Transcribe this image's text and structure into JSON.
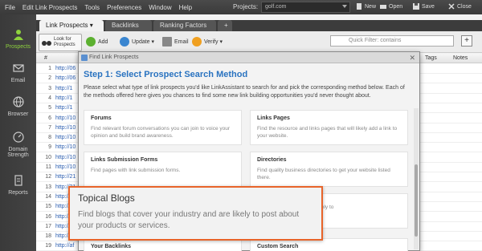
{
  "menu": [
    "File",
    "Edit Link Prospects",
    "Tools",
    "Preferences",
    "Window",
    "Help"
  ],
  "projects": {
    "label": "Projects:",
    "value": "golf.com"
  },
  "top_buttons": {
    "new": "New",
    "open": "Open",
    "save": "Save",
    "close": "Close"
  },
  "sidebar": {
    "items": [
      {
        "label": "Prospects",
        "icon": "person-icon"
      },
      {
        "label": "Email",
        "icon": "envelope-icon"
      },
      {
        "label": "Browser",
        "icon": "globe-icon"
      },
      {
        "label": "Domain Strength",
        "label_lines": [
          "Domain",
          "Strength"
        ],
        "icon": "gauge-icon"
      },
      {
        "label": "Reports",
        "icon": "document-icon"
      }
    ]
  },
  "tabs": [
    "Link Prospects",
    "Backlinks",
    "Ranking Factors",
    "+"
  ],
  "toolbar": {
    "look_for_prospects": [
      "Look for",
      "Prospects"
    ],
    "add": "Add",
    "update": "Update",
    "email": "Email",
    "verify": "Verify",
    "filter_placeholder": "Quick Filter: contains"
  },
  "table": {
    "headers": {
      "num": "#",
      "tags": "Tags",
      "notes": "Notes"
    },
    "rows": [
      {
        "num": "1",
        "url": "http://06"
      },
      {
        "num": "2",
        "url": "http://06"
      },
      {
        "num": "3",
        "url": "http://1"
      },
      {
        "num": "4",
        "url": "http://1"
      },
      {
        "num": "5",
        "url": "http://1"
      },
      {
        "num": "6",
        "url": "http://10"
      },
      {
        "num": "7",
        "url": "http://10"
      },
      {
        "num": "8",
        "url": "http://10"
      },
      {
        "num": "9",
        "url": "http://10"
      },
      {
        "num": "10",
        "url": "http://10"
      },
      {
        "num": "11",
        "url": "http://10"
      },
      {
        "num": "12",
        "url": "http://21"
      },
      {
        "num": "13",
        "url": "http://21"
      },
      {
        "num": "14",
        "url": "http://3"
      },
      {
        "num": "15",
        "url": "http://3"
      },
      {
        "num": "16",
        "url": "http://3"
      },
      {
        "num": "17",
        "url": "http://3"
      },
      {
        "num": "18",
        "url": "http://4"
      },
      {
        "num": "19",
        "url": "http://af"
      }
    ]
  },
  "dialog": {
    "title": "Find Link Prospects",
    "step": "Step 1: Select Prospect Search Method",
    "description": "Please select what type of link prospects you'd like LinkAssistant to search for and pick the corresponding method below. Each of the methods offered here gives you chances to find some new link building opportunities you'd never thought about.",
    "cards": [
      {
        "title": "Forums",
        "desc": "Find relevant forum conversations you can join to voice your opinion and build brand awareness."
      },
      {
        "title": "Links Pages",
        "desc": "Find the resource and links pages that will likely add a link to your website."
      },
      {
        "title": "Links Submission Forms",
        "desc": "Find pages with link submission forms."
      },
      {
        "title": "Directories",
        "desc": "Find quality business directories to get your website listed there."
      },
      {
        "title": "",
        "desc": "your competitors and are likely to"
      },
      {
        "title": "Your Backlinks",
        "desc": ""
      },
      {
        "title": "Custom Search",
        "desc": ""
      }
    ]
  },
  "callout": {
    "title": "Topical Blogs",
    "body": "Find blogs that cover your industry and are likely to post about your products or services."
  },
  "colors": {
    "accent_green": "#8ed23e",
    "link_blue": "#2a5db0",
    "step_blue": "#2a73c0",
    "callout_border": "#e8642a"
  }
}
